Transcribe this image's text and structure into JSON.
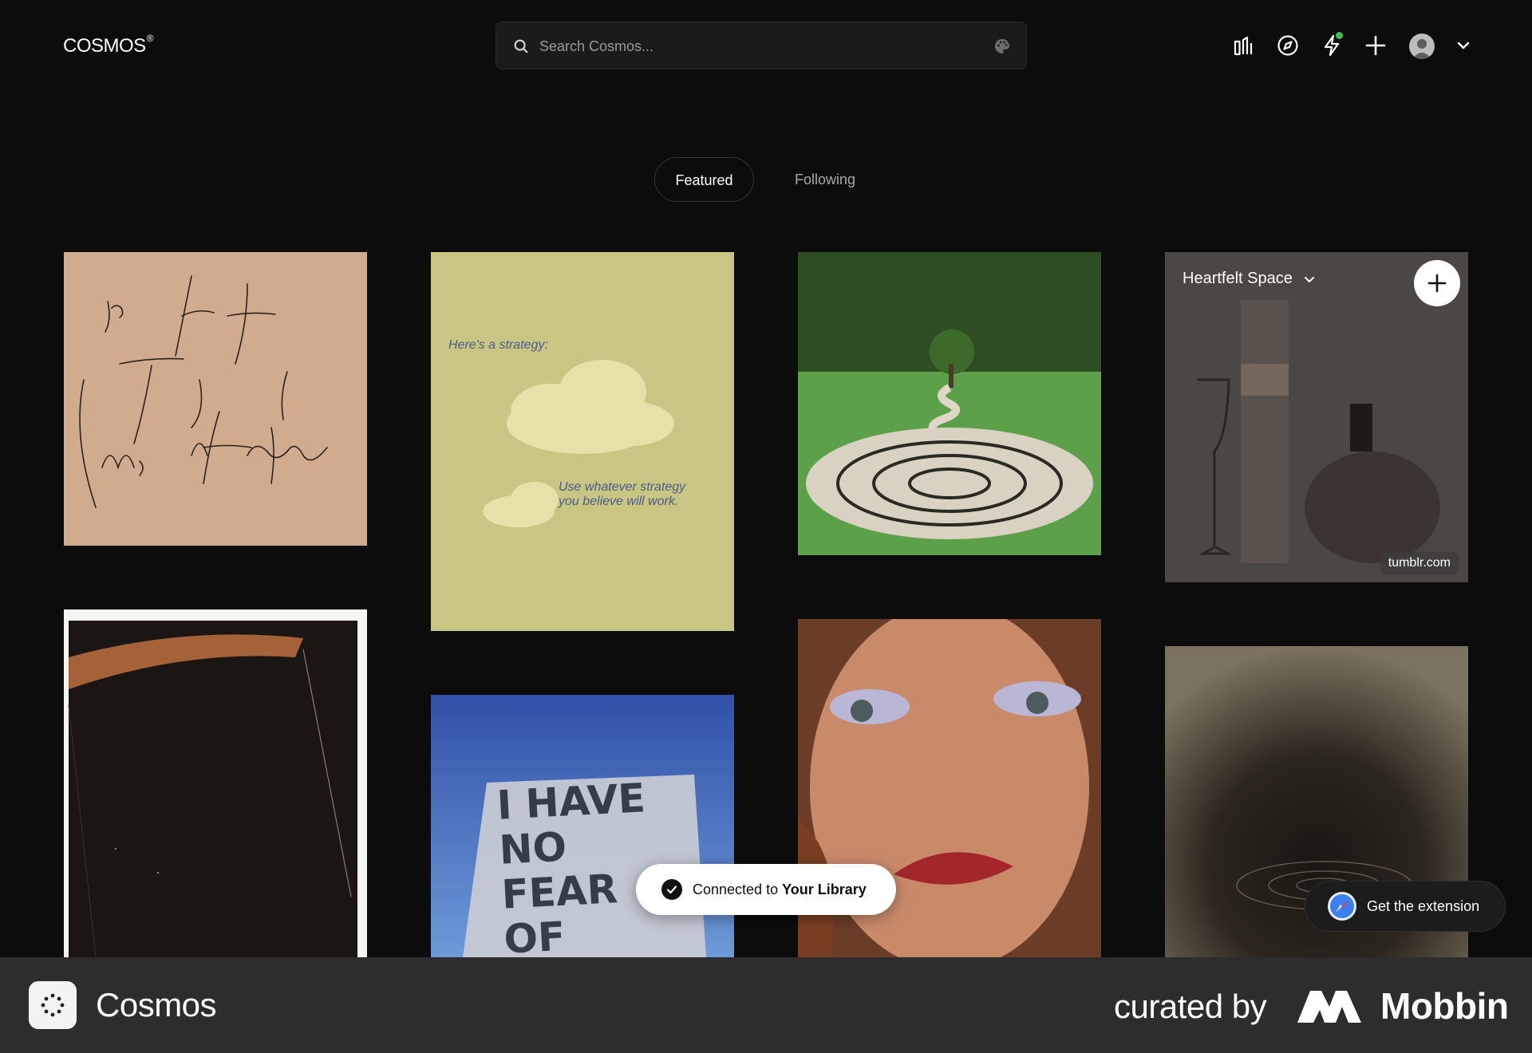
{
  "app": {
    "logo_text": "COSMOS",
    "logo_mark": "®"
  },
  "search": {
    "placeholder": "Search Cosmos...",
    "icon": "search-icon",
    "trailing_icon": "palette-icon"
  },
  "header_icons": [
    "library-icon",
    "compass-icon",
    "lightning-icon",
    "plus-icon",
    "avatar",
    "chevron-down-icon"
  ],
  "notification_dot_color": "#3fbf4c",
  "tabs": [
    {
      "label": "Featured",
      "active": true
    },
    {
      "label": "Following",
      "active": false
    }
  ],
  "feed": {
    "cards": [
      {
        "kind": "handwritten-note",
        "text_lines": [
          "your heart knows",
          "Things that your",
          "mind can't explain"
        ]
      },
      {
        "kind": "cloud-poster",
        "heading": "Here's a strategy:",
        "caption_1": "Use whatever strategy",
        "caption_2": "you believe will work."
      },
      {
        "kind": "spiral-garden-photo"
      },
      {
        "kind": "glassware-photo",
        "board_name": "Heartfelt Space",
        "source": "tumblr.com"
      },
      {
        "kind": "dark-print"
      },
      {
        "kind": "sign-photo",
        "sign_text": "I HAVE NO FEAR OF FAILURE I SEE"
      },
      {
        "kind": "portrait-photo"
      },
      {
        "kind": "ripple-photo"
      }
    ]
  },
  "toast": {
    "prefix": "Connected to ",
    "bold": "Your Library"
  },
  "extension_button": {
    "label": "Get the extension",
    "icon": "safari-icon"
  },
  "footer": {
    "app_name": "Cosmos",
    "curated_by": "curated by",
    "brand": "Mobbin"
  },
  "colors": {
    "background": "#0c0c0c",
    "search_bg": "#1b1b1b",
    "footer_bg": "#2d2d2d",
    "toast_bg": "#ffffff"
  }
}
